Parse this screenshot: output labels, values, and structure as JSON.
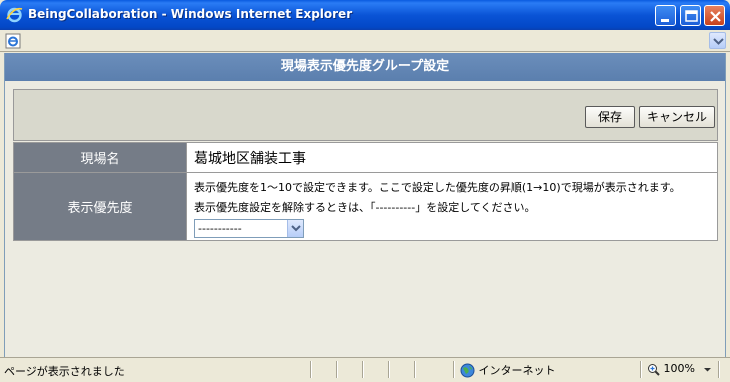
{
  "window": {
    "title": "BeingCollaboration - Windows Internet Explorer"
  },
  "page": {
    "header": "現場表示優先度グループ設定"
  },
  "toolbar": {
    "save_label": "保存",
    "cancel_label": "キャンセル"
  },
  "form": {
    "site_label": "現場名",
    "site_value": "葛城地区舗装工事",
    "priority_label": "表示優先度",
    "help_line1": "表示優先度を1～10で設定できます。ここで設定した優先度の昇順(1→10)で現場が表示されます。",
    "help_line2": "表示優先度設定を解除するときは、「----------」を設定してください。",
    "priority_select_value": "-----------"
  },
  "status": {
    "text": "ページが表示されました",
    "zone": "インターネット",
    "zoom": "100%"
  },
  "colors": {
    "titlebar": "#0a54d6",
    "header": "#6184b3",
    "label_cell": "#757c87"
  }
}
